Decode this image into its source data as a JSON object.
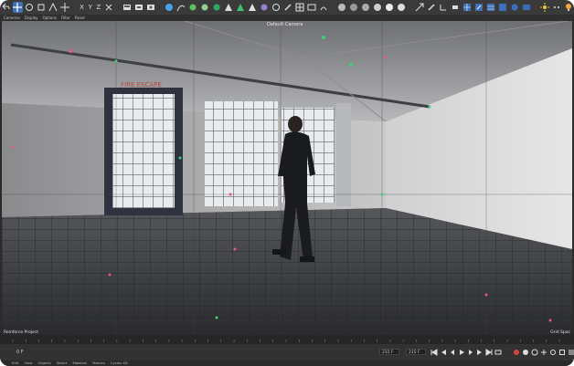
{
  "toolbar": {
    "left_tools": [
      {
        "name": "move-tool-icon",
        "active": true
      },
      {
        "name": "rotate-icon"
      },
      {
        "name": "scale-icon"
      },
      {
        "name": "live-selection-icon"
      }
    ],
    "axis_labels": [
      "X",
      "Y",
      "Z"
    ],
    "coordinate_system": "world-icon",
    "render_tools": [
      "render-view-icon",
      "render-picture-viewer-icon",
      "render-settings-icon"
    ],
    "object_tools": [
      "cube-icon",
      "spline-pen-icon",
      "subdivision-icon",
      "cloner-icon",
      "deformer-icon",
      "environment-icon",
      "camera-icon",
      "light-icon",
      "tag-icon",
      "texture-icon",
      "sculpt-icon"
    ],
    "right_tools": [
      "grid-icon",
      "snapping-icon",
      "workplane-icon",
      "floor-icon",
      "sky-icon",
      "light-bulb-icon"
    ]
  },
  "menubar": {
    "items": [
      "Cameras",
      "Display",
      "Options",
      "Filter",
      "Panel"
    ]
  },
  "viewport": {
    "camera_label": "Default Camera",
    "project_label": "Reinforce Project",
    "grid_label": "Grid Spac",
    "sign_text": "FIRE ESCAPE"
  },
  "timeline": {
    "ticks": [
      "0",
      "5",
      "10",
      "15",
      "20",
      "25",
      "30",
      "35",
      "40",
      "45",
      "50",
      "55",
      "60",
      "65",
      "70",
      "75",
      "80",
      "85",
      "90",
      "95",
      "100",
      "105",
      "110",
      "115",
      "120",
      "125",
      "130",
      "135",
      "140",
      "145",
      "150",
      "155",
      "160",
      "165",
      "170",
      "175",
      "180",
      "185",
      "190",
      "195",
      "200",
      "205",
      "210"
    ],
    "current_frame": "0 F",
    "fps_value": "215 F",
    "end_value": "215 F"
  },
  "bottom_menu": {
    "items": [
      "Edit",
      "View",
      "Objects",
      "Select",
      "Material",
      "Texture",
      "Cycles 4D"
    ]
  },
  "colors": {
    "accent": "#3e6fb8",
    "record": "#d6453a",
    "background": "#2b2b2b"
  }
}
